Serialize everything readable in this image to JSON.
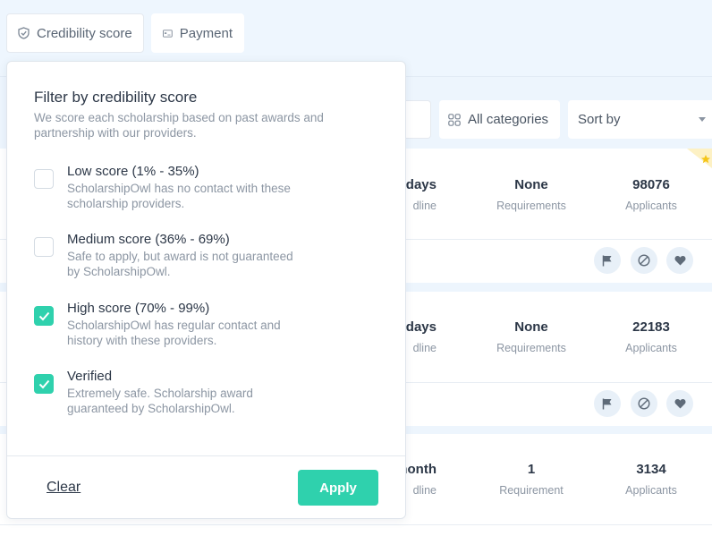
{
  "filters": {
    "credibility_label": "Credibility score",
    "payment_label": "Payment"
  },
  "controls": {
    "categories_label": "All categories",
    "sort_label": "Sort by"
  },
  "cards": [
    {
      "deadline_value": "days",
      "deadline_label": "dline",
      "requirements_value": "None",
      "requirements_label": "Requirements",
      "applicants_value": "98076",
      "applicants_label": "Applicants"
    },
    {
      "deadline_value": ") days",
      "deadline_label": "dline",
      "requirements_value": "None",
      "requirements_label": "Requirements",
      "applicants_value": "22183",
      "applicants_label": "Applicants"
    },
    {
      "deadline_value": "month",
      "deadline_label": "dline",
      "requirements_value": "1",
      "requirements_label": "Requirement",
      "applicants_value": "3134",
      "applicants_label": "Applicants"
    }
  ],
  "panel": {
    "title": "Filter by credibility score",
    "description": "We score each scholarship based on past awards and partnership with our providers.",
    "options": [
      {
        "title": "Low score (1% - 35%)",
        "desc": "ScholarshipOwl has no contact with these scholarship providers.",
        "checked": false
      },
      {
        "title": "Medium score (36% - 69%)",
        "desc": "Safe to apply, but award is not guaranteed by ScholarshipOwl.",
        "checked": false
      },
      {
        "title": "High score (70% - 99%)",
        "desc": "ScholarshipOwl has regular contact and history with these providers.",
        "checked": true
      },
      {
        "title": "Verified",
        "desc": "Extremely safe. Scholarship award guaranteed by ScholarshipOwl.",
        "checked": true
      }
    ],
    "clear_label": "Clear",
    "apply_label": "Apply"
  },
  "colors": {
    "accent": "#2fd1ad",
    "background": "#edf5fd",
    "star": "#f5c518"
  }
}
